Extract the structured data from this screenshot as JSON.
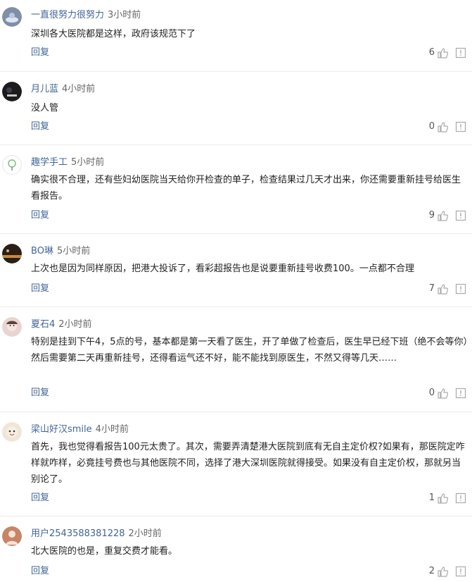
{
  "reply_label": "回复",
  "comments": [
    {
      "username": "一直很努力很努力",
      "time": "3小时前",
      "text": "深圳各大医院都是这样，政府该规范下了",
      "likes": "6"
    },
    {
      "username": "月儿蓝",
      "time": "4小时前",
      "text": "没人管",
      "likes": "0"
    },
    {
      "username": "趣学手工",
      "time": "5小时前",
      "text": "确实很不合理，还有些妇幼医院当天给你开检查的单子，检查结果过几天才出来，你还需要重新挂号给医生看报告。",
      "likes": "9"
    },
    {
      "username": "BO琳",
      "time": "5小时前",
      "text": "上次也是因为同样原因，把港大投诉了，看彩超报告也是说要重新挂号收费100。一点都不合理",
      "likes": "7"
    },
    {
      "username": "夏石4",
      "time": "2小时前",
      "text": "特别是挂到下午4，5点的号，基本都是第一天看了医生，开了单做了检查后，医生早已经下班（绝不会等你）然后需要第二天再重新挂号，还得看运气还不好，能不能找到原医生，不然又得等几天……",
      "likes": "0"
    },
    {
      "username": "梁山好汉smile",
      "time": "4小时前",
      "text": "首先，我也觉得看报告100元太贵了。其次，需要弄清楚港大医院到底有无自主定价权?如果有，那医院定咋样就咋样，必竟挂号费也与其他医院不同，选择了港大深圳医院就得接受。如果没有自主定价权，那就另当别论了。",
      "likes": "1"
    },
    {
      "username": "用户2543588381228",
      "time": "2小时前",
      "text": "北大医院的也是，重复交费才能看。",
      "likes": "2"
    }
  ]
}
